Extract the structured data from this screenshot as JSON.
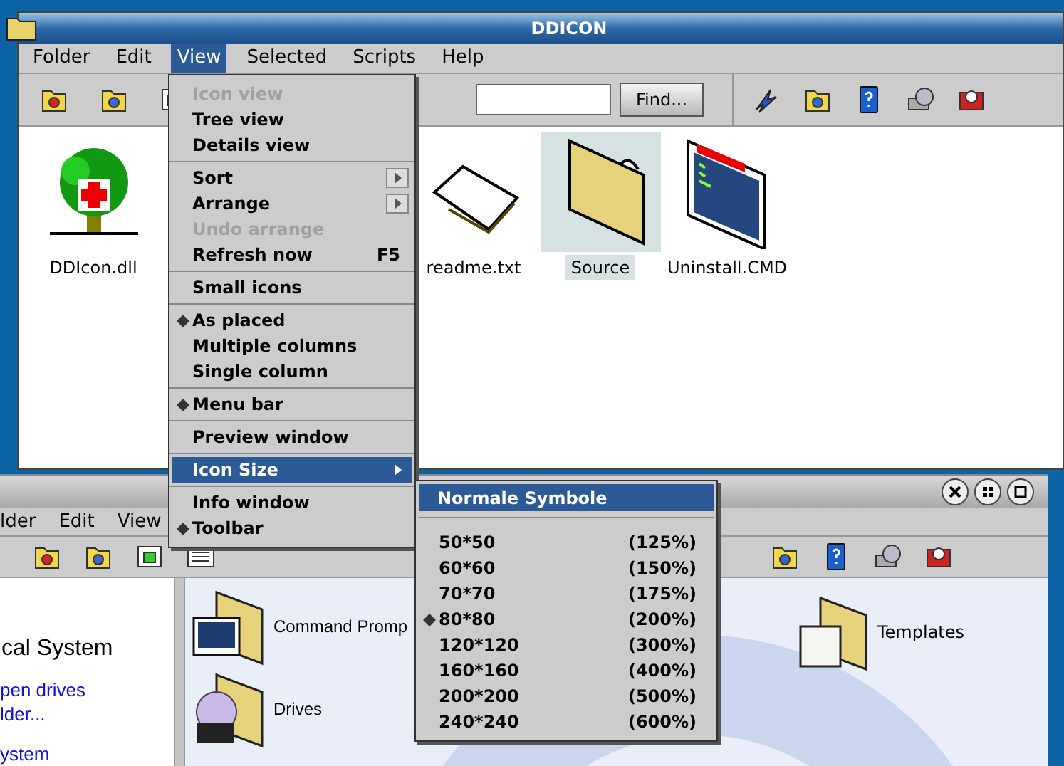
{
  "main_window": {
    "title": "DDICON",
    "menu": [
      {
        "label": "Folder",
        "selected": false
      },
      {
        "label": "Edit",
        "selected": false
      },
      {
        "label": "View",
        "selected": true
      },
      {
        "label": "Selected",
        "selected": false
      },
      {
        "label": "Scripts",
        "selected": false
      },
      {
        "label": "Help",
        "selected": false
      }
    ],
    "find_button": "Find...",
    "files": [
      {
        "name": "DDIcon.dll",
        "kind": "dll",
        "selected": false
      },
      {
        "name": "readme.txt",
        "kind": "text",
        "selected": false
      },
      {
        "name": "Source",
        "kind": "folder",
        "selected": true
      },
      {
        "name": "Uninstall.CMD",
        "kind": "command",
        "selected": false
      }
    ]
  },
  "back_window": {
    "menu": [
      "lder",
      "Edit",
      "View"
    ],
    "left_pane": {
      "heading": "cal System",
      "links": [
        "pen drives",
        "lder...",
        "ystem"
      ]
    },
    "items": [
      {
        "name": "Command Promp",
        "kind": "command"
      },
      {
        "name": "Drives",
        "kind": "drives"
      },
      {
        "name": "Templates",
        "kind": "templates"
      }
    ]
  },
  "view_menu": {
    "groups": [
      [
        {
          "label": "Icon view",
          "disabled": true,
          "checked": false,
          "selected": false,
          "submenu": false
        },
        {
          "label": "Tree view",
          "disabled": false,
          "checked": false,
          "selected": false,
          "submenu": false
        },
        {
          "label": "Details view",
          "disabled": false,
          "checked": false,
          "selected": false,
          "submenu": false
        }
      ],
      [
        {
          "label": "Sort",
          "disabled": false,
          "checked": false,
          "selected": false,
          "submenu": true
        },
        {
          "label": "Arrange",
          "disabled": false,
          "checked": false,
          "selected": false,
          "submenu": true
        },
        {
          "label": "Undo arrange",
          "disabled": true,
          "checked": false,
          "selected": false,
          "submenu": false
        },
        {
          "label": "Refresh now",
          "shortcut": "F5",
          "disabled": false,
          "checked": false,
          "selected": false,
          "submenu": false
        }
      ],
      [
        {
          "label": "Small icons",
          "disabled": false,
          "checked": false,
          "selected": false,
          "submenu": false
        }
      ],
      [
        {
          "label": "As placed",
          "disabled": false,
          "checked": true,
          "selected": false,
          "submenu": false
        },
        {
          "label": "Multiple columns",
          "disabled": false,
          "checked": false,
          "selected": false,
          "submenu": false
        },
        {
          "label": "Single column",
          "disabled": false,
          "checked": false,
          "selected": false,
          "submenu": false
        }
      ],
      [
        {
          "label": "Menu bar",
          "disabled": false,
          "checked": true,
          "selected": false,
          "submenu": false
        }
      ],
      [
        {
          "label": "Preview window",
          "disabled": false,
          "checked": false,
          "selected": false,
          "submenu": false
        }
      ],
      [
        {
          "label": "Icon Size",
          "disabled": false,
          "checked": false,
          "selected": true,
          "submenu": true
        }
      ],
      [
        {
          "label": "Info window",
          "disabled": false,
          "checked": false,
          "selected": false,
          "submenu": false
        },
        {
          "label": "Toolbar",
          "disabled": false,
          "checked": true,
          "selected": false,
          "submenu": false
        }
      ]
    ]
  },
  "icon_size_menu": {
    "header": {
      "label": "Normale Symbole",
      "selected": true
    },
    "items": [
      {
        "size": "50*50",
        "percent": "(125%)",
        "checked": false
      },
      {
        "size": "60*60",
        "percent": "(150%)",
        "checked": false
      },
      {
        "size": "70*70",
        "percent": "(175%)",
        "checked": false
      },
      {
        "size": "80*80",
        "percent": "(200%)",
        "checked": true
      },
      {
        "size": "120*120",
        "percent": "(300%)",
        "checked": false
      },
      {
        "size": "160*160",
        "percent": "(400%)",
        "checked": false
      },
      {
        "size": "200*200",
        "percent": "(500%)",
        "checked": false
      },
      {
        "size": "240*240",
        "percent": "(600%)",
        "checked": false
      }
    ]
  }
}
